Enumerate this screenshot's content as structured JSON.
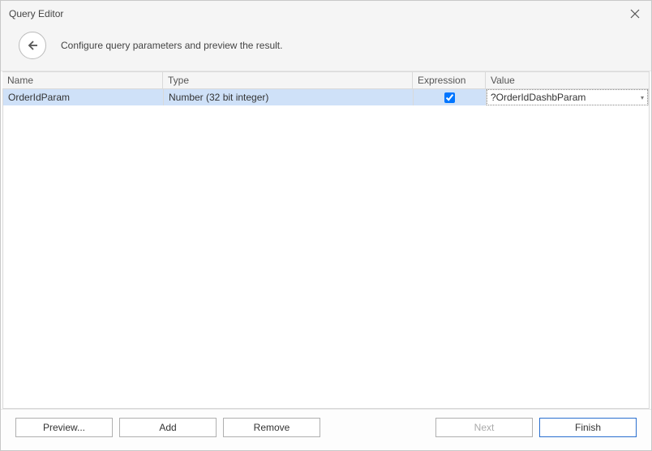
{
  "window": {
    "title": "Query Editor",
    "subtitle": "Configure query parameters and preview the result."
  },
  "columns": {
    "name": "Name",
    "type": "Type",
    "expression": "Expression",
    "value": "Value"
  },
  "rows": [
    {
      "name": "OrderIdParam",
      "type": "Number (32 bit integer)",
      "expression": true,
      "value": "?OrderIdDashbParam",
      "selected": true
    }
  ],
  "buttons": {
    "preview": "Preview...",
    "add": "Add",
    "remove": "Remove",
    "next": "Next",
    "finish": "Finish"
  }
}
